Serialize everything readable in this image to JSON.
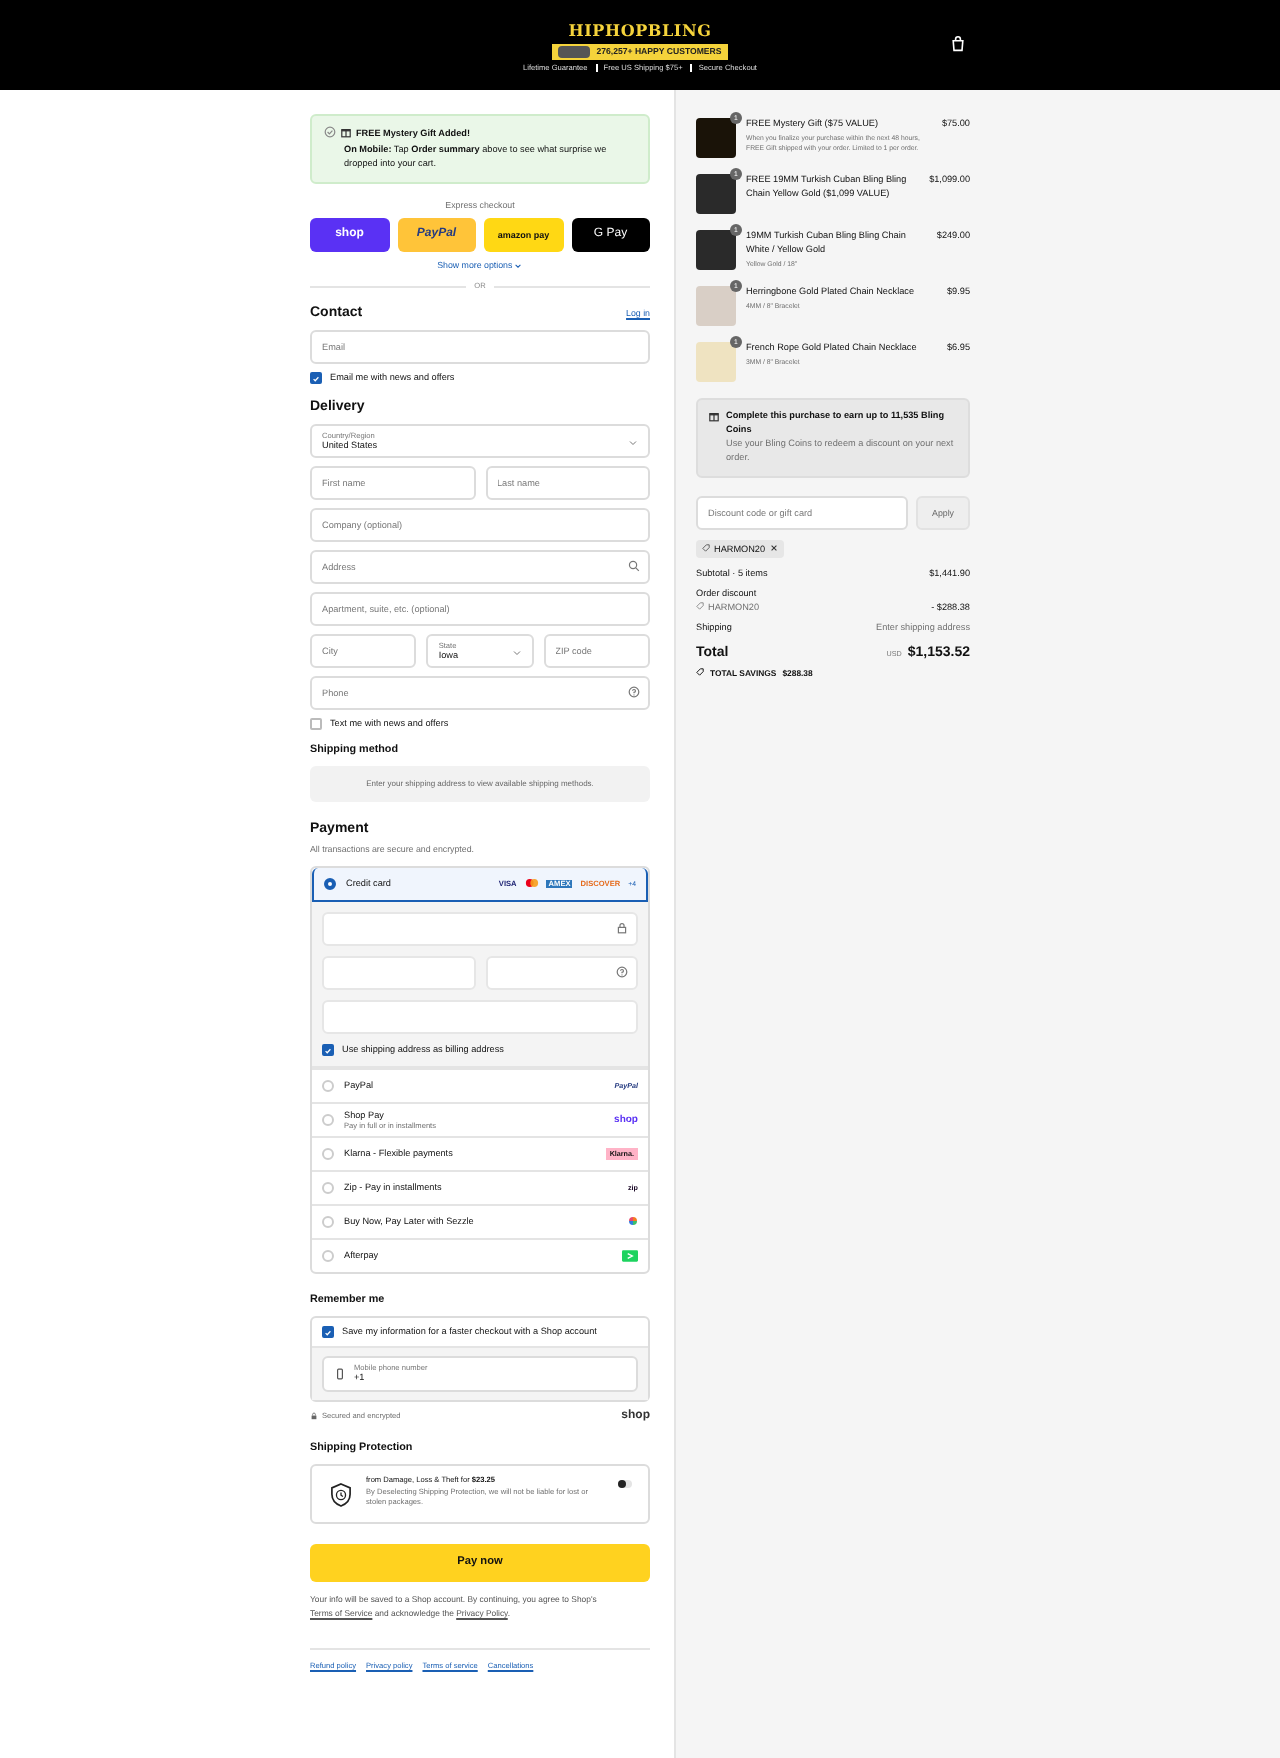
{
  "header": {
    "logo": "HIPHOPBLING",
    "customers_badge": "276,257+ HAPPY CUSTOMERS",
    "trust_items": [
      "Lifetime Guarantee",
      "Free US Shipping $75+",
      "Secure Checkout"
    ]
  },
  "gift_notice": {
    "title": "FREE Mystery Gift Added!",
    "text": "**On Mobile:** Tap **Order summary** above to see what surprise we dropped into your cart."
  },
  "express": {
    "label": "Express checkout",
    "buttons": [
      {
        "kind": "shop",
        "label": "shop"
      },
      {
        "kind": "paypal",
        "label": "PayPal"
      },
      {
        "kind": "amazon",
        "label": "amazon pay"
      },
      {
        "kind": "gpay",
        "label": "G Pay"
      }
    ],
    "more": "Show more options",
    "or": "OR"
  },
  "contact": {
    "heading": "Contact",
    "login": "Log in",
    "email_placeholder": "Email",
    "news": {
      "label": "Email me with news and offers",
      "checked": true
    }
  },
  "delivery": {
    "heading": "Delivery",
    "country": {
      "label": "Country/Region",
      "value": "United States"
    },
    "first_name": {
      "placeholder": "First name"
    },
    "last_name": {
      "placeholder": "Last name"
    },
    "company": {
      "placeholder": "Company (optional)"
    },
    "address": {
      "placeholder": "Address"
    },
    "apartment": {
      "placeholder": "Apartment, suite, etc. (optional)"
    },
    "city": {
      "placeholder": "City"
    },
    "state": {
      "label": "State",
      "value": "Iowa"
    },
    "zip": {
      "placeholder": "ZIP code"
    },
    "phone": {
      "placeholder": "Phone"
    },
    "sms": {
      "label": "Text me with news and offers",
      "checked": false
    }
  },
  "shipping_method": {
    "heading": "Shipping method",
    "notice": "Enter your shipping address to view available shipping methods."
  },
  "payment": {
    "heading": "Payment",
    "subtitle": "All transactions are secure and encrypted.",
    "billing": {
      "label": "Use shipping address as billing address",
      "checked": true
    },
    "card_logos": [
      {
        "kind": "visa",
        "text": "VISA"
      },
      {
        "kind": "mastercard"
      },
      {
        "kind": "amex",
        "text": "AMEX"
      },
      {
        "kind": "discover",
        "text": "DISCOVER"
      }
    ],
    "more_cards": "+4",
    "methods": [
      {
        "kind": "card",
        "label": "Credit card",
        "selected": true
      },
      {
        "kind": "paypal",
        "label": "PayPal",
        "logo": "PayPal",
        "selected": false
      },
      {
        "kind": "shop",
        "label": "Shop Pay",
        "sub": "Pay in full or in installments",
        "logo": "shop",
        "selected": false
      },
      {
        "kind": "klarna",
        "label": "Klarna - Flexible payments",
        "logo": "Klarna.",
        "selected": false
      },
      {
        "kind": "zip",
        "label": "Zip - Pay in installments",
        "logo": "zip",
        "selected": false
      },
      {
        "kind": "sezzle",
        "label": "Buy Now, Pay Later with Sezzle",
        "selected": false
      },
      {
        "kind": "afterpay",
        "label": "Afterpay",
        "selected": false
      }
    ]
  },
  "remember": {
    "heading": "Remember me",
    "save": {
      "label": "Save my information for a faster checkout with a Shop account",
      "checked": true
    },
    "phone": {
      "label": "Mobile phone number",
      "value": "+1"
    },
    "secure": "Secured and encrypted",
    "shop_logo": "shop"
  },
  "protection": {
    "heading": "Shipping Protection",
    "title": "from Damage, Loss & Theft for **$23.25**",
    "text": "By Deselecting Shipping Protection, we will not be liable for lost or stolen packages.",
    "on": false
  },
  "pay_button": "Pay now",
  "legal": {
    "before": "Your info will be saved to a Shop account. By continuing, you agree to Shop's",
    "terms": "Terms of Service",
    "middle": "and acknowledge the",
    "privacy": "Privacy Policy",
    "after": "."
  },
  "footer_links": [
    "Refund policy",
    "Privacy policy",
    "Terms of service",
    "Cancellations"
  ],
  "summary": {
    "items": [
      {
        "kind": "gift",
        "name": "FREE Mystery Gift ($75 VALUE)",
        "note": "When you finalize your purchase within the next 48 hours, FREE Gift shipped with your order. Limited to 1 per order.",
        "price": "$75.00",
        "quantity": "1"
      },
      {
        "kind": "chain",
        "name": "FREE 19MM Turkish Cuban Bling Bling Chain Yellow Gold ($1,099 VALUE)",
        "price": "$1,099.00",
        "quantity": "1"
      },
      {
        "kind": "chain",
        "name": "19MM Turkish Cuban Bling Bling Chain White / Yellow Gold",
        "note": "Yellow Gold / 18\"",
        "price": "$249.00",
        "quantity": "1"
      },
      {
        "kind": "model",
        "name": "Herringbone Gold Plated Chain Necklace",
        "note": "4MM / 8\" Bracelet",
        "price": "$9.95",
        "quantity": "1"
      },
      {
        "kind": "rope",
        "name": "French Rope Gold Plated Chain Necklace",
        "note": "3MM / 8\" Bracelet",
        "price": "$6.95",
        "quantity": "1"
      }
    ],
    "bling": {
      "title": "Complete this purchase to earn up to 11,535 Bling Coins",
      "text": "Use your Bling Coins to redeem a discount on your next order."
    },
    "discount": {
      "placeholder": "Discount code or gift card",
      "button": "Apply",
      "tag": "HARMON20"
    },
    "subtotal": {
      "label": "Subtotal · 5 items",
      "value": "$1,441.90"
    },
    "order_discount": {
      "label": "Order discount",
      "code": "HARMON20",
      "value": "- $288.38"
    },
    "shipping": {
      "label": "Shipping",
      "value": "Enter shipping address"
    },
    "total": {
      "label": "Total",
      "currency": "USD",
      "value": "$1,153.52"
    },
    "savings": {
      "label": "TOTAL SAVINGS",
      "value": "$288.38"
    }
  }
}
